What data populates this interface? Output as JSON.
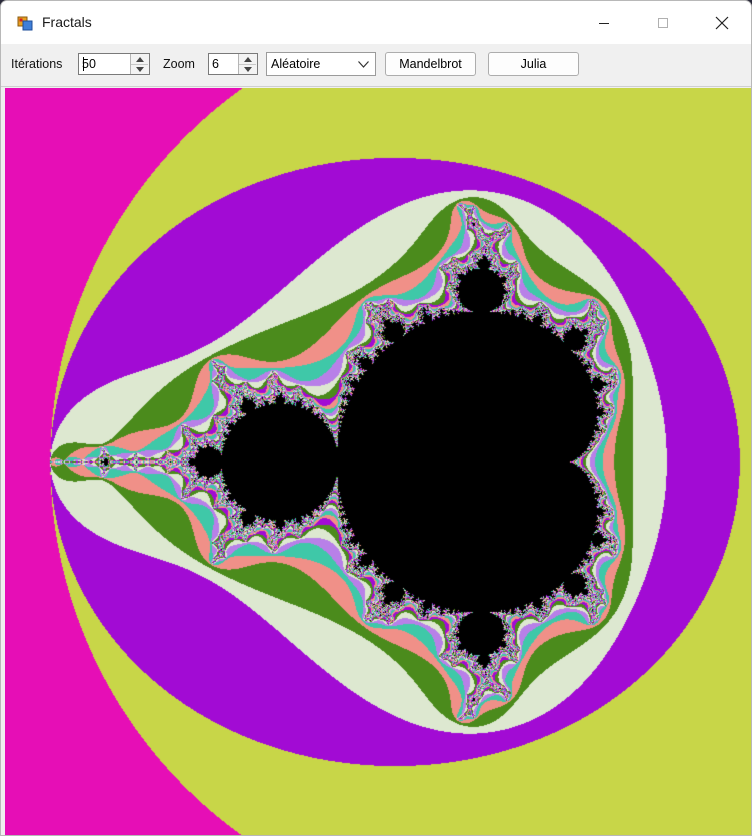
{
  "window": {
    "title": "Fractals",
    "app_icon": "windows-forms-app-icon",
    "caption_buttons": [
      "minimize-icon",
      "maximize-icon",
      "close-icon"
    ]
  },
  "toolbar": {
    "iterations_label": "Itérations",
    "iterations_value": "50",
    "zoom_label": "Zoom",
    "zoom_value": "6",
    "palette_selected": "Aléatoire",
    "mandelbrot_button": "Mandelbrot",
    "julia_button": "Julia"
  },
  "canvas": {
    "fractal": "Mandelbrot",
    "max_iterations": 50,
    "colors": {
      "background": "#28a62e",
      "band_1": "#e60eb6",
      "band_2": "#c8d648",
      "band_3": "#a20bd4",
      "band_4": "#dde8d0",
      "band_5": "#4b8b1c",
      "inner_set": "#000000",
      "fringe_1": "#f09088",
      "fringe_2": "#3fc8a8",
      "fringe_3": "#b880e8"
    }
  }
}
